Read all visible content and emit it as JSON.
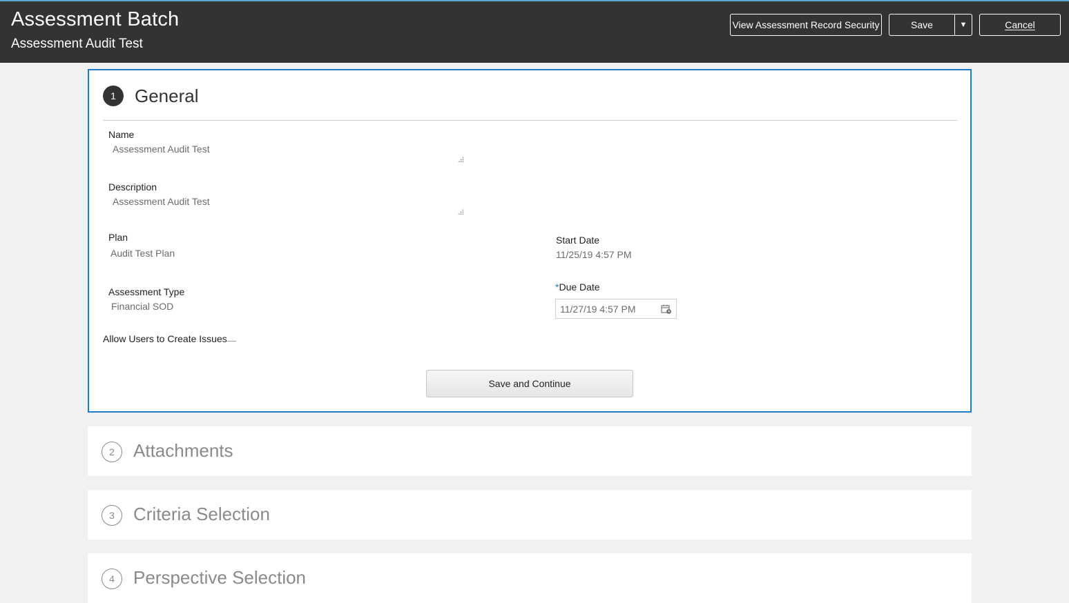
{
  "header": {
    "title": "Assessment Batch",
    "subtitle": "Assessment Audit Test",
    "view_security_label": "View Assessment Record Security",
    "save_label": "Save",
    "cancel_label": "Cancel"
  },
  "steps": [
    {
      "number": "1",
      "title": "General"
    },
    {
      "number": "2",
      "title": "Attachments"
    },
    {
      "number": "3",
      "title": "Criteria Selection"
    },
    {
      "number": "4",
      "title": "Perspective Selection"
    }
  ],
  "general": {
    "name_label": "Name",
    "name_value": "Assessment Audit Test",
    "description_label": "Description",
    "description_value": "Assessment Audit Test",
    "plan_label": "Plan",
    "plan_value": "Audit Test Plan",
    "assessment_type_label": "Assessment Type",
    "assessment_type_value": "Financial SOD",
    "start_date_label": "Start Date",
    "start_date_value": "11/25/19 4:57 PM",
    "due_date_required": "*",
    "due_date_label": "Due Date",
    "due_date_value": "11/27/19 4:57 PM",
    "allow_issues_label": "Allow Users to Create Issues",
    "save_continue_label": "Save and Continue"
  },
  "colors": {
    "header_bg": "#333333",
    "accent": "#1f7ac4",
    "page_bg": "#f1f1f1"
  }
}
